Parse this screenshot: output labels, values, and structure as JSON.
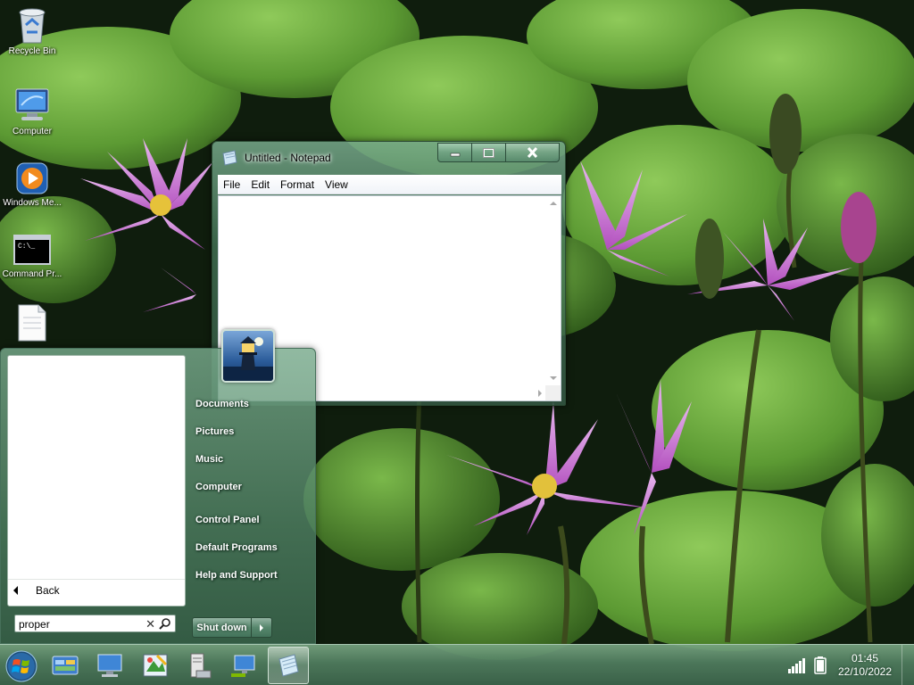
{
  "desktop": {
    "icons": [
      {
        "label": "Recycle Bin",
        "icon": "recycle-bin-icon"
      },
      {
        "label": "Computer",
        "icon": "computer-icon"
      },
      {
        "label": "Windows Me...",
        "icon": "windows-media-player-icon"
      },
      {
        "label": "Command Pr...",
        "icon": "command-prompt-icon"
      },
      {
        "label": "",
        "icon": "text-document-icon"
      }
    ]
  },
  "notepad": {
    "title": "Untitled - Notepad",
    "menu": [
      "File",
      "Edit",
      "Format",
      "View"
    ],
    "content": "",
    "controls": {
      "minimize": "minimize-icon",
      "maximize": "maximize-icon",
      "close": "close-icon"
    }
  },
  "start_menu": {
    "back_label": "Back",
    "search": {
      "value": "proper",
      "placeholder": ""
    },
    "right_items": [
      "Documents",
      "Pictures",
      "Music",
      "Computer",
      "Control Panel",
      "Default Programs",
      "Help and Support"
    ],
    "shutdown_label": "Shut down"
  },
  "taskbar": {
    "start_icon": "windows-start-orb-icon",
    "pinned": [
      {
        "icon": "control-panel-icon"
      },
      {
        "icon": "remote-desktop-icon"
      },
      {
        "icon": "paint-icon"
      },
      {
        "icon": "file-server-icon"
      },
      {
        "icon": "network-computer-icon"
      },
      {
        "icon": "notepad-icon",
        "active": true
      }
    ],
    "tray": {
      "signal_icon": "signal-strength-icon",
      "battery_icon": "battery-icon",
      "time": "01:45",
      "date": "22/10/2022"
    }
  }
}
